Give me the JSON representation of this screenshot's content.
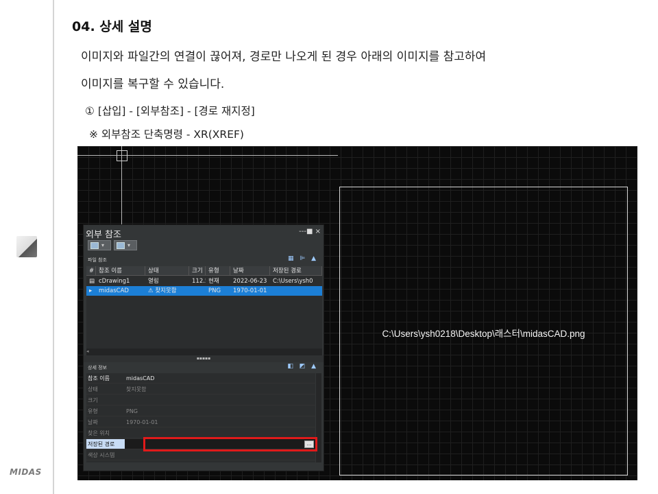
{
  "page": {
    "heading": "04. 상세 설명",
    "para1": "이미지와 파일간의 연결이 끊어져, 경로만 나오게 된 경우 아래의 이미지를 참고하여",
    "para2": "이미지를 복구할 수 있습니다.",
    "step": "①  [삽입] - [외부참조] - [경로 재지정]",
    "note": "※ 외부참조 단축명령 - XR(XREF)",
    "logo": "MIDAS"
  },
  "cad": {
    "image_path": "C:\\Users\\ysh0218\\Desktop\\래스터\\midasCAD.png",
    "palette": {
      "title": "외부 참조",
      "controls": "---■ ×",
      "section_files": "파일 참조",
      "section_details": "상세 정보",
      "columns": [
        "#",
        "참조 이름",
        "상태",
        "크기",
        "유형",
        "날짜",
        "저장된 경로"
      ],
      "rows": [
        {
          "icon": "dwg-icon",
          "name": "cDrawing1",
          "status": "열림",
          "size": "112.5...",
          "type": "현재",
          "date": "2022-06-23",
          "path": "C:\\Users\\ysh0"
        },
        {
          "icon": "image-icon",
          "name": "midasCAD",
          "status": "⚠ 찾지못함",
          "size": "",
          "type": "PNG",
          "date": "1970-01-01",
          "path": ""
        }
      ],
      "details": [
        {
          "key": "참조 이름",
          "value": "midasCAD"
        },
        {
          "key": "상태",
          "value": "찾지못함"
        },
        {
          "key": "크기",
          "value": ""
        },
        {
          "key": "유형",
          "value": "PNG"
        },
        {
          "key": "날짜",
          "value": "1970-01-01"
        },
        {
          "key": "찾은 위치",
          "value": ""
        },
        {
          "key": "저장된 경로",
          "value": ""
        },
        {
          "key": "색상 시스템",
          "value": ""
        }
      ],
      "browse_label": "..."
    }
  },
  "colors": {
    "highlight": "#1c7fd6",
    "callout": "#e01a1a"
  }
}
